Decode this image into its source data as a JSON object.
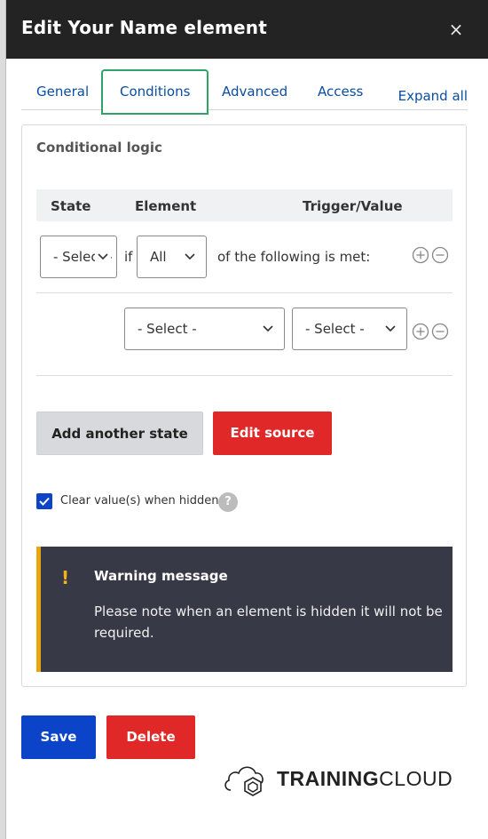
{
  "dialog": {
    "title": "Edit Your Name element",
    "close_glyph": "×"
  },
  "tabs": [
    {
      "label": "General"
    },
    {
      "label": "Conditions",
      "active": true
    },
    {
      "label": "Advanced"
    },
    {
      "label": "Access"
    }
  ],
  "expand_all": "Expand all",
  "panel": {
    "title": "Conditional logic",
    "columns": {
      "state": "State",
      "element": "Element",
      "trigger": "Trigger/Value"
    },
    "row1": {
      "state_select": "- Select -",
      "if_text": "if",
      "all_select": "All",
      "suffix": "of the following is met:"
    },
    "row2": {
      "element_select": "- Select -",
      "value_select": "- Select -"
    },
    "add_state_button": "Add another state",
    "edit_source_button": "Edit source",
    "clear_values_label": "Clear value(s) when hidden",
    "clear_values_checked": true,
    "help_glyph": "?"
  },
  "warning": {
    "icon_glyph": "!",
    "title": "Warning message",
    "body": "Please note when an element is hidden it will not be required."
  },
  "footer": {
    "save_button": "Save",
    "delete_button": "Delete"
  },
  "logo": {
    "text_bold": "TRAINING",
    "text_regular": "CLOUD"
  },
  "colors": {
    "header_bg": "#232323",
    "tab_active_border": "#2da36a",
    "link": "#0a4da2",
    "danger": "#e02828",
    "primary": "#0b44c9",
    "warning_bg": "#383946",
    "warning_accent": "#e8a60e"
  },
  "icons": [
    "close-icon",
    "chevron-down-icon",
    "add-circle-icon",
    "remove-circle-icon",
    "check-icon",
    "help-icon",
    "warning-icon",
    "trainingcloud-logo-icon"
  ]
}
